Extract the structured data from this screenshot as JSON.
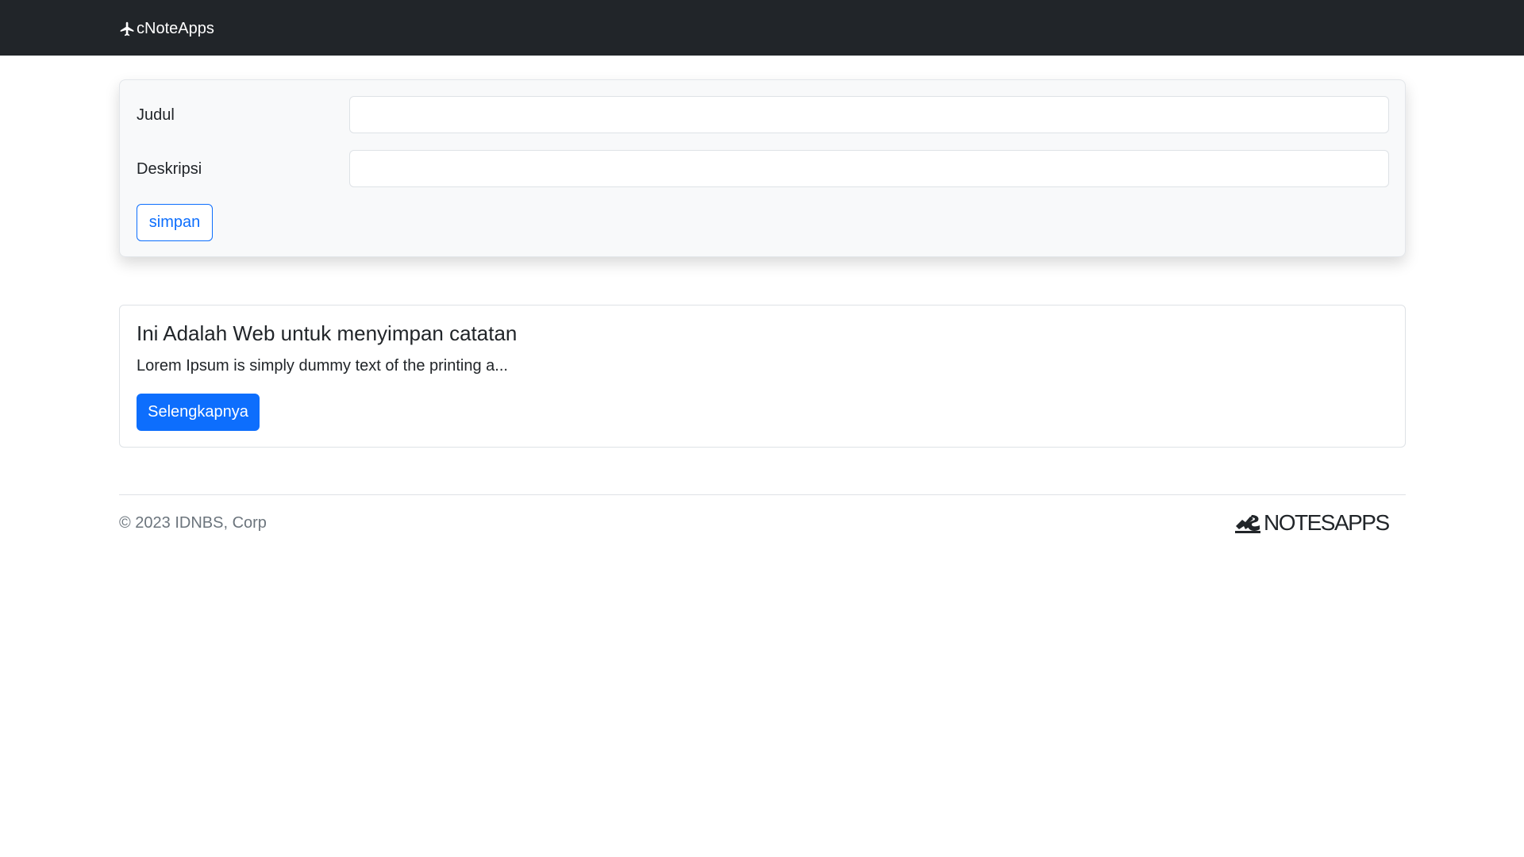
{
  "navbar": {
    "brand_icon": "airplane-icon",
    "brand_label": "cNoteApps"
  },
  "form": {
    "title_label": "Judul",
    "title_value": "",
    "title_placeholder": "",
    "description_label": "Deskripsi",
    "description_value": "",
    "description_placeholder": "",
    "submit_label": "simpan"
  },
  "notes": [
    {
      "title": "Ini Adalah Web untuk menyimpan catatan",
      "excerpt": "Lorem Ipsum is simply dummy text of the printing a...",
      "button_label": "Selengkapnya"
    }
  ],
  "footer": {
    "copyright": "© 2023 IDNBS, Corp",
    "logo_icon": "notesapps-logo-icon",
    "logo_text": "NOTESAPPS"
  },
  "colors": {
    "navbar_bg": "#212529",
    "primary": "#0d6efd",
    "muted_text": "#6c757d",
    "form_bg": "#f8f9fa"
  }
}
